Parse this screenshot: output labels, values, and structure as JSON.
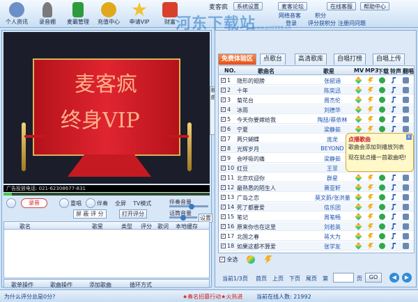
{
  "toolbar": {
    "items": [
      {
        "label": "个人资讯",
        "icon": "user-icon",
        "color": "#6b8fc7"
      },
      {
        "label": "录音棚",
        "icon": "microphone-icon",
        "color": "#7a7a7a"
      },
      {
        "label": "麦霸管理",
        "icon": "book-icon",
        "color": "#2e9b3e"
      },
      {
        "label": "充值中心",
        "icon": "coins-icon",
        "color": "#e0a81c"
      },
      {
        "label": "申请VIP",
        "icon": "star-icon",
        "color": "#f2c230"
      },
      {
        "label": "财富",
        "icon": "gift-icon",
        "color": "#d8402c"
      }
    ],
    "brand": "麦客疯",
    "sys_settings": "系统设置",
    "forum": "麦客论坛",
    "online_service": "在线客服",
    "help_center": "帮助中心",
    "row2": [
      "网络音客",
      "积分"
    ],
    "row3": [
      "登录",
      "评分获积分",
      "注册问问题"
    ],
    "watermark": "河东下载站",
    "watermark_url": "www.pc0359.cn"
  },
  "video": {
    "banner_line1": "麦客疯",
    "banner_line2": "终身VIP",
    "side_tab": "歌曲",
    "ad_text": "广告投放电话: 021-62308677-831",
    "progress": 0.04
  },
  "controls": {
    "record": "录音",
    "repeat": "重唱",
    "accompany": "伴奏",
    "fullscreen": "全屏",
    "tv_mode": "TV模式",
    "accomp_volume": "伴奏音量",
    "score_display": "屏 蔽 评 分",
    "open_score": "打开评分",
    "music_volume": "话筒音量",
    "settings": "设置"
  },
  "playlist": {
    "columns": [
      "歌名",
      "歌星",
      "类型",
      "评分",
      "歌词",
      "本地缓存"
    ]
  },
  "left_bottom": {
    "song_ops": "歌单操作",
    "lyric_ops": "歌曲操作",
    "add_song": "添加歌曲",
    "loop_mode": "循环方式"
  },
  "right": {
    "tabs": [
      "免费体验区",
      "点歌台",
      "高清歌库",
      "自唱打榜",
      "自唱上传"
    ],
    "columns": [
      "NO.",
      "歌曲名",
      "歌星",
      "MV",
      "MP3",
      "下载",
      "铃声",
      "翻唱"
    ],
    "rows": [
      {
        "no": "1",
        "name": "隐形的翅膀",
        "singer": "张韶涵"
      },
      {
        "no": "2",
        "name": "十年",
        "singer": "陈奕迅"
      },
      {
        "no": "3",
        "name": "菊花台",
        "singer": "周杰伦"
      },
      {
        "no": "4",
        "name": "冰雨",
        "singer": "刘德华"
      },
      {
        "no": "5",
        "name": "今天你要嫁给我",
        "singer": "陶喆/蔡依林"
      },
      {
        "no": "6",
        "name": "宁夏",
        "singer": "梁静茹"
      },
      {
        "no": "7",
        "name": "两只蝴蝶",
        "singer": "庞龙"
      },
      {
        "no": "8",
        "name": "光辉岁月",
        "singer": "BEYOND"
      },
      {
        "no": "9",
        "name": "会呼吸的痛",
        "singer": "梁静茹"
      },
      {
        "no": "10",
        "name": "红豆",
        "singer": "王菲"
      },
      {
        "no": "11",
        "name": "北京欢迎你",
        "singer": "群星"
      },
      {
        "no": "12",
        "name": "最熟悉的陌生人",
        "singer": "萧亚轩"
      },
      {
        "no": "13",
        "name": "广岛之恋",
        "singer": "莫文蔚/张洪量"
      },
      {
        "no": "14",
        "name": "死了都要爱",
        "singer": "信乐团"
      },
      {
        "no": "15",
        "name": "笔记",
        "singer": "周笔畅"
      },
      {
        "no": "16",
        "name": "原来你也在这里",
        "singer": "刘若英"
      },
      {
        "no": "17",
        "name": "北国之春",
        "singer": "蒋大为"
      },
      {
        "no": "18",
        "name": "如果这都不算爱",
        "singer": "张学友"
      }
    ],
    "tooltip_title": "点播歌曲",
    "tooltip_line1": "歌曲会添加到播放列表",
    "tooltip_line2": "现在就点播一首歌曲吧!",
    "select_all": "全选",
    "pager": {
      "info": "当前1/3页",
      "first": "首页",
      "prev": "上页",
      "next": "下页",
      "last": "尾页",
      "goto": "第",
      "page_unit": "页",
      "go": "GO"
    }
  },
  "status": {
    "left": "为什么评分总是0分?",
    "middle": "★奏名招募行动★火热进",
    "right": "当前在线人数: 21992"
  }
}
